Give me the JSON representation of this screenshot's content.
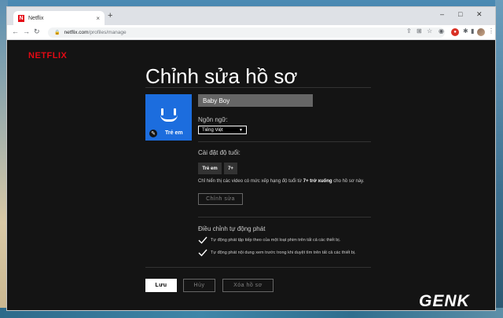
{
  "browser": {
    "tab_favicon": "N",
    "tab_title": "Netflix",
    "tab_close": "×",
    "new_tab": "+",
    "url_host": "netflix.com",
    "url_path": "/profiles/manage",
    "minimize": "–",
    "maximize": "□",
    "close": "✕"
  },
  "netflix": {
    "logo": "NETFLIX",
    "heading": "Chỉnh sửa hồ sơ",
    "profile_badge": "Trẻ em",
    "profile_name": "Baby Boy",
    "language_label": "Ngôn ngữ:",
    "language_value": "Tiếng Việt",
    "maturity_label": "Cài đặt độ tuổi:",
    "maturity_chips": [
      "Trẻ em",
      "7+"
    ],
    "maturity_desc_prefix": "Chỉ hiển thị các video có mức xếp hạng độ tuổi từ ",
    "maturity_desc_bold": "7+ trở xuống",
    "maturity_desc_suffix": " cho hồ sơ này.",
    "edit_button": "Chỉnh sửa",
    "autoplay_label": "Điều chỉnh tự động phát",
    "autoplay_next": "Tự động phát tập tiếp theo của một loạt phim trên tất cả các thiết bị.",
    "autoplay_previews": "Tự động phát nội dung xem trước trong khi duyệt tìm trên tất cả các thiết bị.",
    "save_button": "Lưu",
    "cancel_button": "Hủy",
    "delete_button": "Xóa hồ sơ"
  },
  "watermark": "GENK",
  "colors": {
    "netflix_red": "#e50914",
    "profile_blue": "#1c6dde",
    "page_bg": "#141414"
  }
}
